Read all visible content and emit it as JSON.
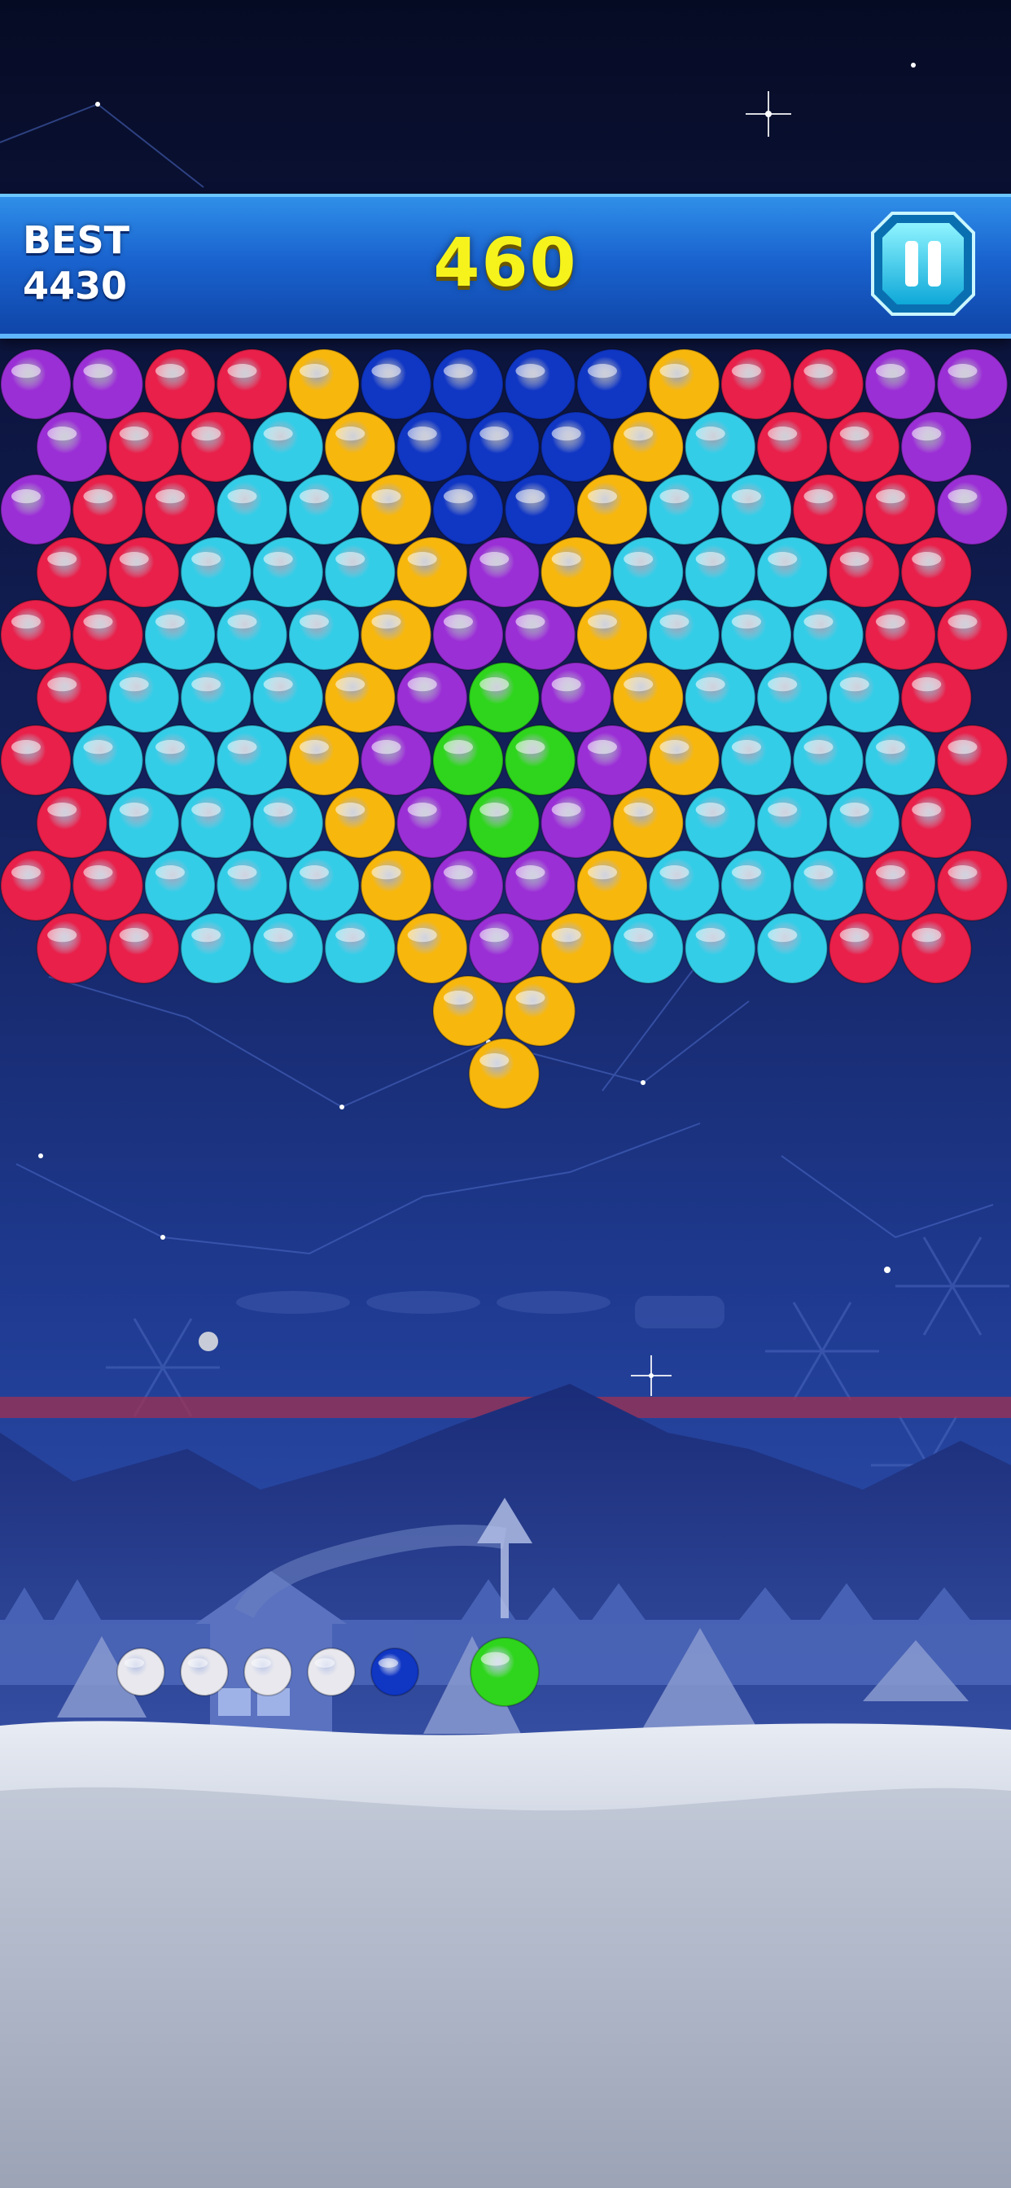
{
  "hud": {
    "best_label": "BEST",
    "best_value": "4430",
    "score": "460"
  },
  "colors": {
    "purple": "#9b2fd6",
    "red": "#e8204a",
    "yellow": "#f8b70c",
    "blue": "#1036c4",
    "cyan": "#34cde8",
    "green": "#2ed51c",
    "white": "#e8e8ee"
  },
  "icons": {
    "pause": "pause-icon",
    "aim": "aim-arrow-icon"
  },
  "grid": {
    "rows": [
      [
        "P",
        "P",
        "R",
        "R",
        "Y",
        "B",
        "B",
        "B",
        "B",
        "Y",
        "R",
        "R",
        "P",
        "P"
      ],
      [
        "P",
        "R",
        "R",
        "C",
        "Y",
        "B",
        "B",
        "B",
        "Y",
        "C",
        "R",
        "R",
        "P"
      ],
      [
        "P",
        "R",
        "R",
        "C",
        "C",
        "Y",
        "B",
        "B",
        "Y",
        "C",
        "C",
        "R",
        "R",
        "P"
      ],
      [
        "R",
        "R",
        "C",
        "C",
        "C",
        "Y",
        "P",
        "Y",
        "C",
        "C",
        "C",
        "R",
        "R"
      ],
      [
        "R",
        "R",
        "C",
        "C",
        "C",
        "Y",
        "P",
        "P",
        "Y",
        "C",
        "C",
        "C",
        "R",
        "R"
      ],
      [
        "R",
        "C",
        "C",
        "C",
        "Y",
        "P",
        "G",
        "P",
        "Y",
        "C",
        "C",
        "C",
        "R"
      ],
      [
        "R",
        "C",
        "C",
        "C",
        "Y",
        "P",
        "G",
        "G",
        "P",
        "Y",
        "C",
        "C",
        "C",
        "R"
      ],
      [
        "R",
        "C",
        "C",
        "C",
        "Y",
        "P",
        "G",
        "P",
        "Y",
        "C",
        "C",
        "C",
        "R"
      ],
      [
        "R",
        "R",
        "C",
        "C",
        "C",
        "Y",
        "P",
        "P",
        "Y",
        "C",
        "C",
        "C",
        "R",
        "R"
      ],
      [
        "R",
        "R",
        "C",
        "C",
        "C",
        "Y",
        "P",
        "Y",
        "C",
        "C",
        "C",
        "R",
        "R"
      ],
      [
        "",
        "",
        "",
        "",
        "",
        "",
        "Y",
        "Y",
        "",
        "",
        "",
        "",
        "",
        ""
      ],
      [
        "",
        "",
        "",
        "",
        "",
        "",
        "Y",
        "",
        "",
        "",
        "",
        "",
        ""
      ]
    ]
  },
  "shooter": {
    "current": "G",
    "next": "B",
    "queue": [
      "W",
      "W",
      "W",
      "W"
    ]
  }
}
